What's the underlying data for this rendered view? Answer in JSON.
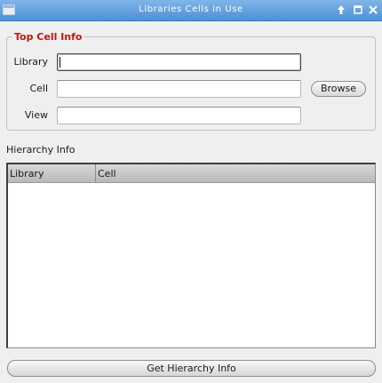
{
  "window": {
    "title": "Libraries Cells in Use",
    "titlebar_color": "#5a9ad9"
  },
  "top_cell_info": {
    "legend": "Top Cell Info",
    "legend_color": "#c81414",
    "library_label": "Library",
    "library_value": "",
    "cell_label": "Cell",
    "cell_value": "",
    "view_label": "View",
    "view_value": "",
    "browse_label": "Browse"
  },
  "hierarchy": {
    "label": "Hierarchy Info",
    "columns": [
      "Library",
      "Cell"
    ],
    "rows": []
  },
  "actions": {
    "get_hierarchy_label": "Get Hierarchy Info"
  }
}
